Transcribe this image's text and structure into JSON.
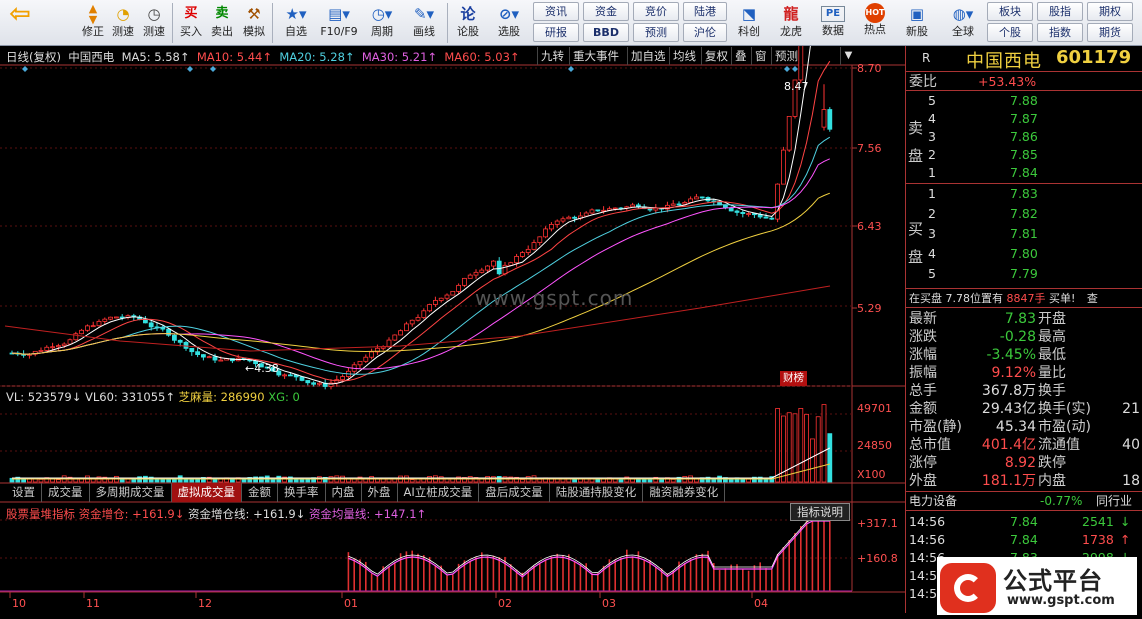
{
  "toolbar": {
    "buttons": [
      {
        "label": "修正",
        "icon": "up-down-arrows-icon"
      },
      {
        "label": "测速",
        "icon": "speedometer-icon"
      },
      {
        "label": "买入",
        "icon": "buy-icon",
        "glyph": "买"
      },
      {
        "label": "卖出",
        "icon": "sell-icon",
        "glyph": "卖"
      },
      {
        "label": "模拟",
        "icon": "gavel-icon"
      },
      {
        "label": "自选",
        "icon": "star-folder-icon"
      },
      {
        "label": "F10/F9",
        "icon": "info-panel-icon"
      },
      {
        "label": "周期",
        "icon": "clock-cycle-icon"
      },
      {
        "label": "画线",
        "icon": "pen-icon"
      },
      {
        "label": "论股",
        "icon": "discuss-icon",
        "glyph": "论"
      },
      {
        "label": "选股",
        "icon": "magnifier-chart-icon"
      },
      {
        "label": "科创",
        "icon": "kechuang-icon"
      },
      {
        "label": "龙虎",
        "icon": "dragon-icon"
      },
      {
        "label": "数据",
        "icon": "pe-data-icon"
      },
      {
        "label": "热点",
        "icon": "hot-icon"
      },
      {
        "label": "新股",
        "icon": "new-stock-icon"
      },
      {
        "label": "全球",
        "icon": "globe-icon"
      }
    ],
    "boxes": [
      "资讯",
      "资金",
      "竞价",
      "陆港",
      "研报",
      "BBD",
      "预测",
      "沪伦",
      "板块",
      "股指",
      "期权",
      "个股",
      "指数",
      "期货"
    ]
  },
  "chart": {
    "header": {
      "period": "日线(复权)",
      "name": "中国西电",
      "ma5": "MA5: 5.58↑",
      "ma10": "MA10: 5.44↑",
      "ma20": "MA20: 5.28↑",
      "ma30": "MA30: 5.21↑",
      "ma60": "MA60: 5.03↑"
    },
    "buttons": [
      "九转",
      "重大事件",
      "加自选",
      "均线",
      "复权",
      "叠",
      "窗",
      "预测"
    ],
    "price_ticks": [
      "8.70",
      "7.56",
      "6.43",
      "5.29"
    ],
    "high_label": "8.47",
    "low_label": "4.38",
    "badge": "财榜",
    "watermark": "www.gspt.com",
    "vol_header": {
      "vl": "VL: 523579↓",
      "vl60": "VL60: 331055↑",
      "zhima": "芝麻量: 286990",
      "xg": "XG: 0"
    },
    "vol_ticks": [
      "49701",
      "24850",
      "X100"
    ],
    "tabs": [
      "设置",
      "成交量",
      "多周期成交量",
      "虚拟成交量",
      "金额",
      "换手率",
      "内盘",
      "外盘",
      "AI立桩成交量",
      "盘后成交量",
      "陆股通持股变化",
      "融资融券变化"
    ],
    "ind_header": {
      "name": "股票量堆指标",
      "a": "资金增仓: +161.9↓",
      "b": "资金增仓线: +161.9↓",
      "c": "资金均量线: +147.1↑"
    },
    "ind_button": "指标说明",
    "ind_ticks": [
      "+317.1",
      "+160.8"
    ],
    "x_labels": [
      "10",
      "11",
      "12",
      "01",
      "02",
      "03",
      "04"
    ]
  },
  "quote": {
    "r_label": "R",
    "name": "中国西电",
    "code": "601179",
    "weibi_label": "委比",
    "weibi": "+53.43%",
    "sell_label": "卖盘",
    "buy_label": "买盘",
    "sell": [
      {
        "lv": "5",
        "p": "7.88"
      },
      {
        "lv": "4",
        "p": "7.87"
      },
      {
        "lv": "3",
        "p": "7.86"
      },
      {
        "lv": "2",
        "p": "7.85"
      },
      {
        "lv": "1",
        "p": "7.84"
      }
    ],
    "buy": [
      {
        "lv": "1",
        "p": "7.83"
      },
      {
        "lv": "2",
        "p": "7.82"
      },
      {
        "lv": "3",
        "p": "7.81"
      },
      {
        "lv": "4",
        "p": "7.80"
      },
      {
        "lv": "5",
        "p": "7.79"
      }
    ],
    "status": "在买盘 7.78位置有",
    "status_qty": "8847手",
    "status_tail": "买单!",
    "status_btn": "查",
    "stats": [
      {
        "l": "最新",
        "v": "7.83",
        "l2": "开盘"
      },
      {
        "l": "涨跌",
        "v": "-0.28",
        "l2": "最高"
      },
      {
        "l": "涨幅",
        "v": "-3.45%",
        "l2": "最低"
      },
      {
        "l": "振幅",
        "v": "9.12%",
        "l2": "量比"
      },
      {
        "l": "总手",
        "v": "367.8万",
        "l2": "换手"
      },
      {
        "l": "金额",
        "v": "29.43亿",
        "l2": "换手(实)",
        "v2": "21"
      },
      {
        "l": "市盈(静)",
        "v": "45.34",
        "l2": "市盈(动)"
      },
      {
        "l": "总市值",
        "v": "401.4亿",
        "l2": "流通值",
        "v2": "40"
      },
      {
        "l": "涨停",
        "v": "8.92",
        "l2": "跌停"
      },
      {
        "l": "外盘",
        "v": "181.1万",
        "l2": "内盘",
        "v2": "18"
      }
    ],
    "sector": "电力设备",
    "sector_chg": "-0.77%",
    "sector_tail": "同行业",
    "ticks": [
      {
        "t": "14:56",
        "p": "7.84",
        "v": "2541",
        "d": "down"
      },
      {
        "t": "14:56",
        "p": "7.84",
        "v": "1738",
        "d": "up"
      },
      {
        "t": "14:56",
        "p": "7.83",
        "v": "2998",
        "d": "down"
      },
      {
        "t": "14:56",
        "p": "",
        "v": "",
        "d": ""
      },
      {
        "t": "14:56",
        "p": "",
        "v": "",
        "d": ""
      }
    ]
  },
  "logo": {
    "text": "公式平台",
    "url": "www.gspt.com"
  },
  "colors": {
    "up": "#ff3333",
    "down": "#33e0e0",
    "ma5": "#ffffff",
    "ma10": "#ff4444",
    "ma20": "#4fd0e0",
    "ma30": "#ff55ff",
    "ma60": "#f0d040"
  }
}
